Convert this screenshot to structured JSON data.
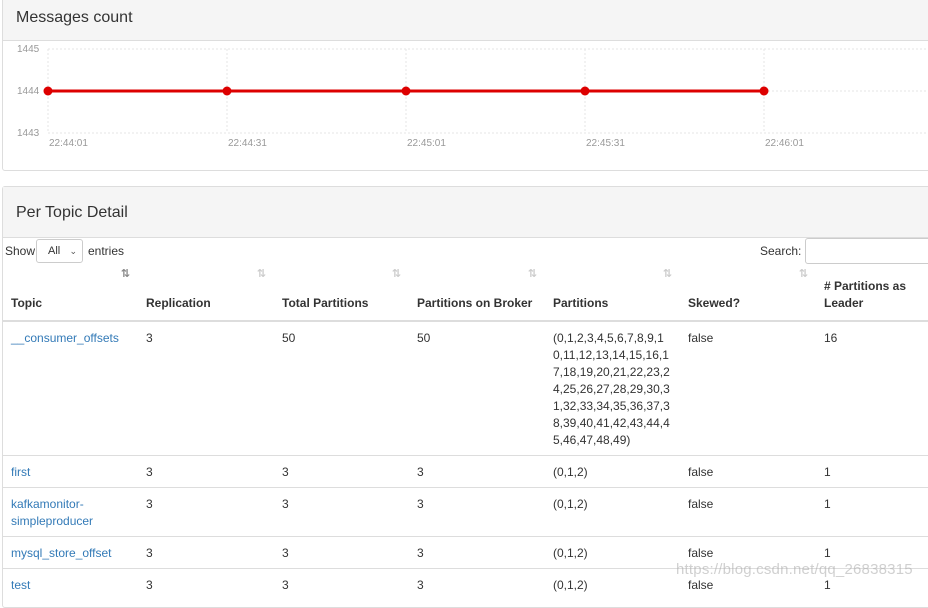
{
  "messages_panel": {
    "title": "Messages count"
  },
  "chart_data": {
    "type": "line",
    "title": "",
    "xlabel": "",
    "ylabel": "",
    "ylim": [
      1443,
      1445
    ],
    "yticks": [
      "1445",
      "1444",
      "1443"
    ],
    "x": [
      "22:44:01",
      "22:44:31",
      "22:45:01",
      "22:45:31",
      "22:46:01"
    ],
    "series": [
      {
        "values": [
          1444,
          1444,
          1444,
          1444,
          1444
        ],
        "color": "#dd0000"
      }
    ],
    "grid": true,
    "legend": "none"
  },
  "topic_panel": {
    "title": "Per Topic Detail"
  },
  "controls": {
    "show_label": "Show",
    "length_value": "All",
    "entries_label": "entries",
    "search_label": "Search:",
    "search_value": ""
  },
  "table": {
    "columns": [
      "Topic",
      "Replication",
      "Total Partitions",
      "Partitions on Broker",
      "Partitions",
      "Skewed?",
      "# Partitions as Leader"
    ],
    "rows": [
      {
        "topic": "__consumer_offsets",
        "replication": "3",
        "total": "50",
        "on_broker": "50",
        "partitions": "(0,1,2,3,4,5,6,7,8,9,10,11,12,13,14,15,16,17,18,19,20,21,22,23,24,25,26,27,28,29,30,31,32,33,34,35,36,37,38,39,40,41,42,43,44,45,46,47,48,49)",
        "skewed": "false",
        "leader": "16"
      },
      {
        "topic": "first",
        "replication": "3",
        "total": "3",
        "on_broker": "3",
        "partitions": "(0,1,2)",
        "skewed": "false",
        "leader": "1"
      },
      {
        "topic": "kafkamonitor-simpleproducer",
        "replication": "3",
        "total": "3",
        "on_broker": "3",
        "partitions": "(0,1,2)",
        "skewed": "false",
        "leader": "1"
      },
      {
        "topic": "mysql_store_offset",
        "replication": "3",
        "total": "3",
        "on_broker": "3",
        "partitions": "(0,1,2)",
        "skewed": "false",
        "leader": "1"
      },
      {
        "topic": "test",
        "replication": "3",
        "total": "3",
        "on_broker": "3",
        "partitions": "(0,1,2)",
        "skewed": "false",
        "leader": "1"
      }
    ]
  },
  "watermark": "https://blog.csdn.net/qq_26838315"
}
